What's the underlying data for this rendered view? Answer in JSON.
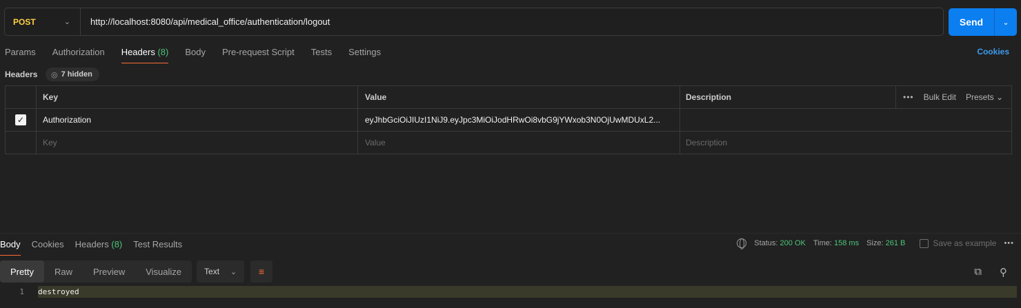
{
  "request": {
    "method": "POST",
    "url": "http://localhost:8080/api/medical_office/authentication/logout",
    "send_label": "Send"
  },
  "request_tabs": [
    {
      "label": "Params"
    },
    {
      "label": "Authorization"
    },
    {
      "label": "Headers",
      "count": "(8)"
    },
    {
      "label": "Body"
    },
    {
      "label": "Pre-request Script"
    },
    {
      "label": "Tests"
    },
    {
      "label": "Settings"
    }
  ],
  "cookies_link": "Cookies",
  "headers_section": {
    "label": "Headers",
    "hidden_badge": "7 hidden",
    "columns": {
      "key": "Key",
      "value": "Value",
      "description": "Description"
    },
    "actions": {
      "bulk_edit": "Bulk Edit",
      "presets": "Presets"
    },
    "rows": [
      {
        "checked": true,
        "key": "Authorization",
        "value": "eyJhbGciOiJIUzI1NiJ9.eyJpc3MiOiJodHRwOi8vbG9jYWxob3N0OjUwMDUxL2...",
        "description": ""
      }
    ],
    "placeholders": {
      "key": "Key",
      "value": "Value",
      "description": "Description"
    }
  },
  "response": {
    "tabs": [
      {
        "label": "Body"
      },
      {
        "label": "Cookies"
      },
      {
        "label": "Headers",
        "count": "(8)"
      },
      {
        "label": "Test Results"
      }
    ],
    "status_label": "Status:",
    "status_value": "200 OK",
    "time_label": "Time:",
    "time_value": "158 ms",
    "size_label": "Size:",
    "size_value": "261 B",
    "save_example": "Save as example",
    "view_modes": [
      "Pretty",
      "Raw",
      "Preview",
      "Visualize"
    ],
    "format": "Text",
    "body_lines": [
      {
        "num": "1",
        "text": "destroyed"
      }
    ]
  },
  "colors": {
    "accent": "#ff6c37",
    "send": "#0b7ef0",
    "method": "#ffcf44",
    "status_ok": "#4dc47a"
  }
}
